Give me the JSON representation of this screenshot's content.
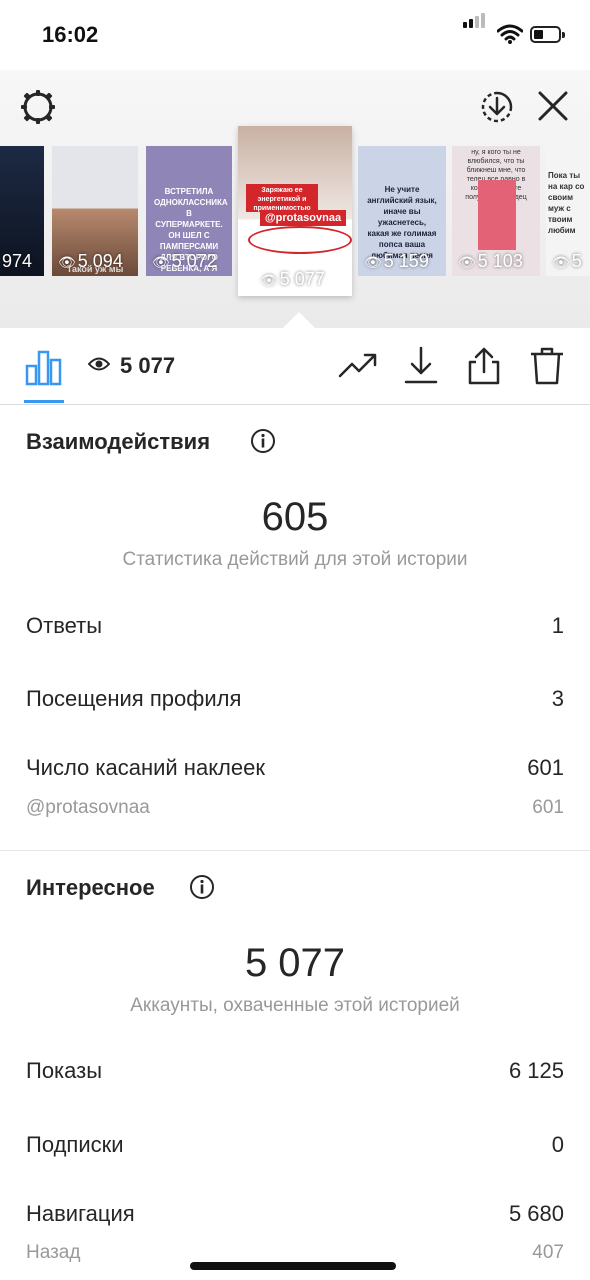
{
  "status_bar": {
    "time": "16:02"
  },
  "stories": [
    {
      "views": "974"
    },
    {
      "views": "5 094",
      "text": "Такой уж мы"
    },
    {
      "views": "5 072",
      "text": "ВСТРЕТИЛА ОДНОКЛАССНИКА В СУПЕРМАРКЕТЕ. ОН ШЕЛ С ПАМПЕРСАМИ ДЛЯ ВТОРОГО РЕБЕНКА, А Я СТАРАЛАСЬ НА ШВЫ МЕЖДУ ПЛИТКАМИ НЕ НАСТУПАТЬ."
    },
    {
      "views": "5 077",
      "text": "Заряжаю ее энергетикой и применимостью",
      "sticker": "@protasovnaa",
      "selected": true
    },
    {
      "views": "5 159",
      "text": "Не учите английский язык, иначе вы ужаснетесь, какая же голимая попса ваша любимая песня"
    },
    {
      "views": "5 103",
      "text": "ну, я кого ты не влюбился, что ты ближнеш мне, что телец все равно в конечном счете получается пиздец"
    },
    {
      "views": "5",
      "text": "Пока ты на кар со своим муж с твоим любим"
    }
  ],
  "toolbar": {
    "views": "5 077"
  },
  "interactions": {
    "title": "Взаимодействия",
    "total": "605",
    "subtitle": "Статистика действий для этой истории",
    "rows": [
      {
        "label": "Ответы",
        "value": "1"
      },
      {
        "label": "Посещения профиля",
        "value": "3"
      },
      {
        "label": "Число касаний наклеек",
        "value": "601"
      }
    ],
    "sticker_row": {
      "label": "@protasovnaa",
      "value": "601"
    }
  },
  "discovery": {
    "title": "Интересное",
    "total": "5 077",
    "subtitle": "Аккаунты, охваченные этой историей",
    "rows": [
      {
        "label": "Показы",
        "value": "6 125"
      },
      {
        "label": "Подписки",
        "value": "0"
      },
      {
        "label": "Навигация",
        "value": "5 680"
      }
    ],
    "back_row": {
      "label": "Назад",
      "value": "407"
    }
  }
}
